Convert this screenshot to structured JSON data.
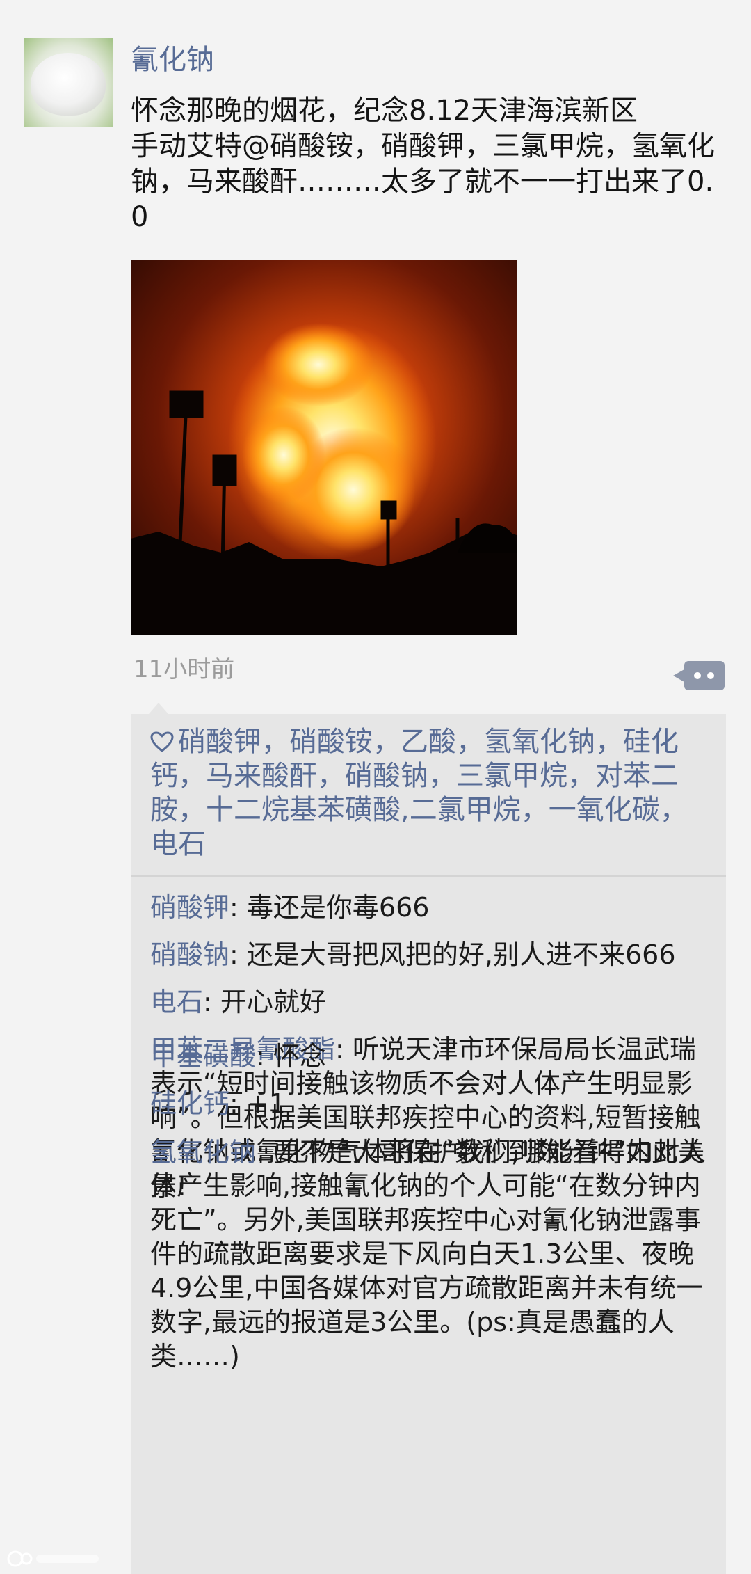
{
  "post": {
    "username": "氰化钠",
    "text": "怀念那晚的烟花，纪念8.12天津海滨新区\n手动艾特@硝酸铵，硝酸钾，三氯甲烷，氢氧化钠，马来酸酐………太多了就不一一打出来了0.0",
    "timestamp": "11小时前"
  },
  "likes": {
    "text": "硝酸钾，硝酸铵，乙酸，氢氧化钠，硅化钙，马来酸酐，硝酸钠，三氯甲烷，对苯二胺，十二烷基苯磺酸,二氯甲烷，一氧化碳，电石"
  },
  "comments": [
    {
      "author": "硝酸钾",
      "text": "毒还是你毒666"
    },
    {
      "author": "硝酸钠",
      "text": "还是大哥把风把的好,别人进不来666"
    },
    {
      "author": "电石",
      "text": "开心就好"
    },
    {
      "author": "甲苯二异氰酸酯",
      "text": "听说天津市环保局局长温武瑞表示“短时间接触该物质不会对人体产生明显影响”。但根据美国联邦疾控中心的资料,短暂接触氰化钠或氰化物气体将在“数秒到数分钟”内对人体产生影响,接触氰化钠的个人可能“在数分钟内死亡”。另外,美国联邦疾控中心对氰化钠泄露事件的疏散距离要求是下风向白天1.3公里、夜晚4.9公里,中国各媒体对官方疏散距离并未有统一数字,最远的报道是3公里。(ps:真是愚蠢的人类……)"
    },
    {
      "author": "甲基磺酸",
      "text": "怀念"
    },
    {
      "author": "硅化钙",
      "text": "+1"
    },
    {
      "author": "氢氧化钠",
      "text": "要不是大哥保护我们,哪能看得如此美景!"
    }
  ],
  "colors": {
    "name_link": "#576b95",
    "background": "#f3f3f3",
    "interaction_box": "#e6e6e6",
    "timestamp": "#9b9b9b"
  },
  "icons": {
    "comment_button": "ellipsis-comment-icon",
    "like": "heart-outline-icon"
  }
}
